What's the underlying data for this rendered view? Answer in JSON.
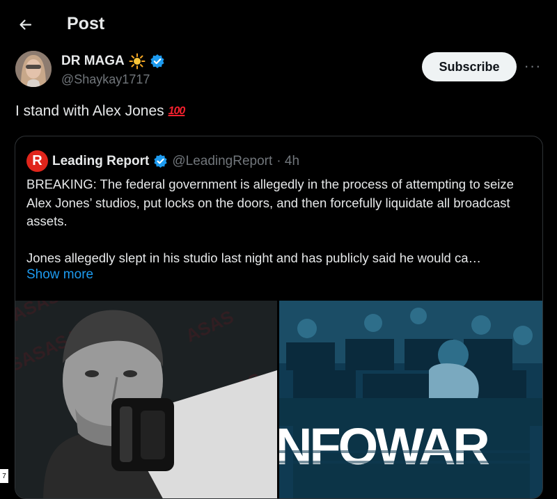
{
  "header": {
    "title": "Post"
  },
  "author": {
    "name": "DR MAGA",
    "handle": "@Shaykay1717",
    "subscribe_label": "Subscribe",
    "more_label": "···"
  },
  "post": {
    "text": "I stand with Alex Jones",
    "emoji": "100"
  },
  "quote": {
    "logo_letter": "R",
    "name": "Leading Report",
    "handle": "@LeadingReport",
    "time": "· 4h",
    "paragraph1": "BREAKING: The federal government is allegedly in the process of attempting to seize Alex Jones’ studios, put locks on the doors, and then forcefully liquidate all broadcast assets.",
    "paragraph2": "Jones allegedly slept in his studio last night and has publicly said he would ca…",
    "show_more": "Show more"
  },
  "media": {
    "right_banner": "NFOWAR"
  },
  "corner": {
    "text": "7"
  },
  "colors": {
    "accent": "#1d9bf0",
    "background": "#000000",
    "muted": "#71767b",
    "brand_red": "#e0251b"
  }
}
